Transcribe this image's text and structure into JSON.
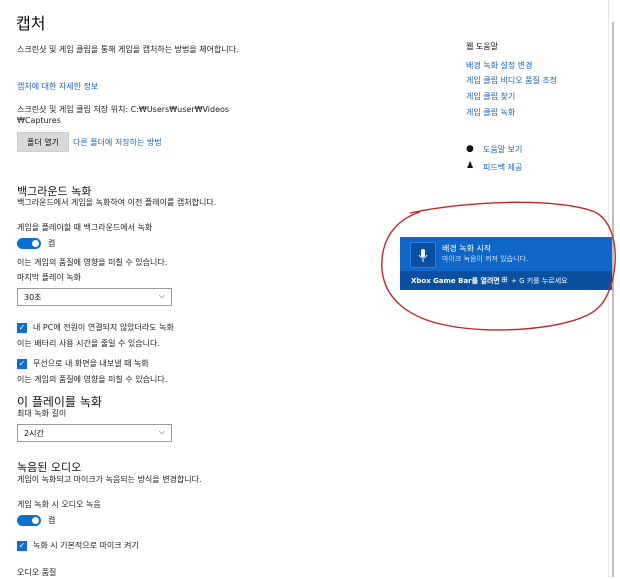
{
  "page": {
    "title": "캡처",
    "intro": "스크린샷 및 게임 클립을 통해 게임을 캡처하는 방법을 제어합니다.",
    "more_link": "캡처에 대한 자세한 정보",
    "save_location_label": "스크린샷 및 게임 클립 저장 위치: C:₩Users₩user₩Videos",
    "save_location_cont": "₩Captures",
    "open_folder_button": "폴더 열기",
    "other_folder_link": "다른 폴더에 저장하는 방법"
  },
  "background": {
    "heading": "백그라운드 녹화",
    "desc": "백그라운드에서 게임을 녹화하여 이전 플레이를 캡처합니다.",
    "toggle_label": "게임을 플레이할 때 백그라운드에서 녹화",
    "toggle_state": "켬",
    "toggle_note": "이는 게임의 품질에 영향을 미칠 수 있습니다.",
    "last_play_label": "마지막 플레이 녹화",
    "last_play_value": "30초",
    "check1_label": "내 PC에 전원이 연결되지 않았더라도 녹화",
    "check1_note": "이는 배터리 사용 시간을 줄일 수 있습니다.",
    "check2_label": "무선으로 내 화면을 내보낼 때 녹화",
    "check2_note": "이는 게임의 품질에 영향을 미칠 수 있습니다."
  },
  "this_play": {
    "heading": "이 플레이를 녹화",
    "max_label": "최대 녹화 길이",
    "max_value": "2시간"
  },
  "audio": {
    "heading": "녹음된 오디오",
    "desc": "게임이 녹화되고 마이크가 녹음되는 방식을 변경합니다.",
    "toggle_label": "게임 녹화 시 오디오 녹음",
    "toggle_state": "켬",
    "check_label": "녹화 시 기본적으로 마이크 켜기",
    "quality_label": "오디오 품질"
  },
  "sidebar": {
    "heading": "웹 도움말",
    "links": [
      "배경 녹화 설정 변경",
      "게임 클립 비디오 품질 조정",
      "게임 클립 찾기",
      "게임 클립 녹화"
    ],
    "help_link": "도움말 보기",
    "feedback_link": "피드백 제공"
  },
  "toast": {
    "title": "배경 녹화 시작",
    "subtitle": "마이크 녹음이 켜져 있습니다.",
    "footer_prefix": "Xbox Game Bar를 열려면",
    "footer_suffix": "+ G 키를 누르세요"
  },
  "annotation_color": "#c0282d",
  "colors": {
    "accent": "#0b6fd1",
    "link": "#1a63b8",
    "toast": "#0e67c8"
  }
}
